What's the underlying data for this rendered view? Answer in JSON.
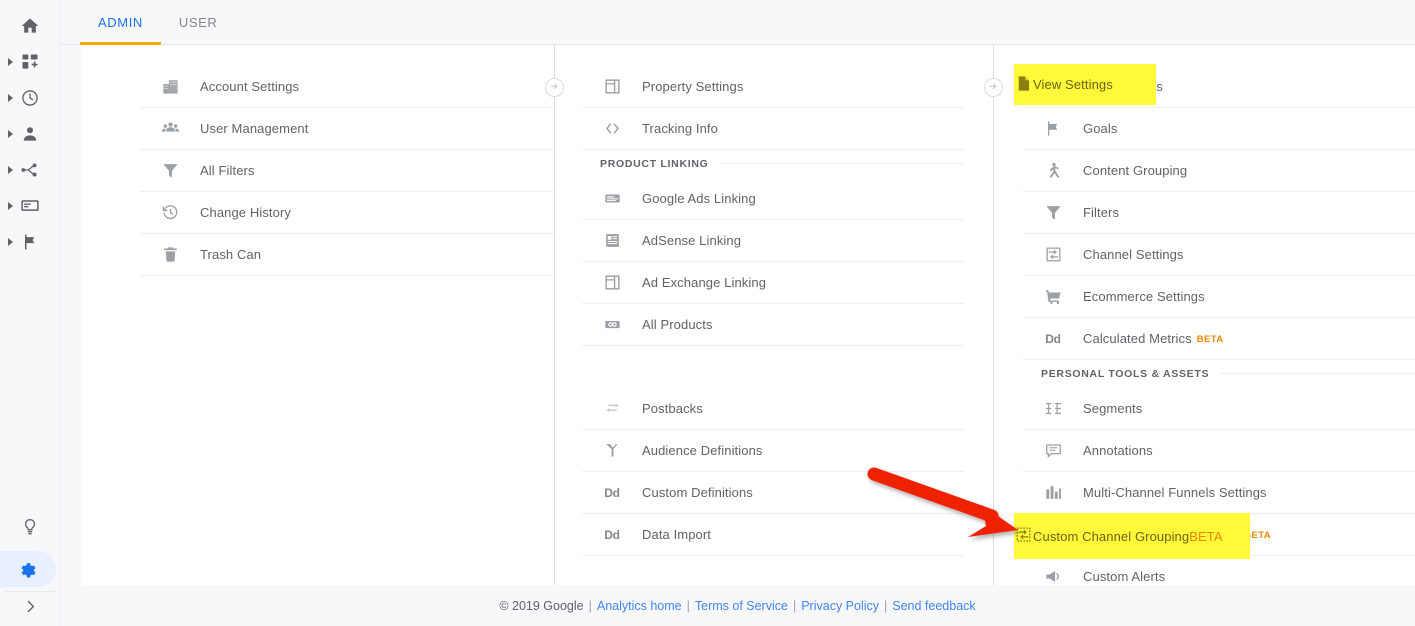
{
  "app": {
    "title": "Google Analytics Admin",
    "accent_blue": "#1a73e8",
    "accent_yellow": "#f9ab00",
    "highlight_color": "#fff93a",
    "annotation_color": "#ee2400"
  },
  "sidebar": {
    "items": [
      {
        "name": "home",
        "label": "Home",
        "icon": "home-icon",
        "expandable": false
      },
      {
        "name": "customization",
        "label": "Customization",
        "icon": "customization-icon",
        "expandable": true
      },
      {
        "name": "realtime",
        "label": "Realtime",
        "icon": "clock-icon",
        "expandable": true
      },
      {
        "name": "audience",
        "label": "Audience",
        "icon": "person-icon",
        "expandable": true
      },
      {
        "name": "acquisition",
        "label": "Acquisition",
        "icon": "share-nodes-icon",
        "expandable": true
      },
      {
        "name": "behavior",
        "label": "Behavior",
        "icon": "window-icon",
        "expandable": true
      },
      {
        "name": "conversions",
        "label": "Conversions",
        "icon": "flag-icon",
        "expandable": true
      }
    ],
    "bottom": [
      {
        "name": "discover",
        "label": "Discover",
        "icon": "lightbulb-icon",
        "active": false
      },
      {
        "name": "admin",
        "label": "Admin",
        "icon": "gear-icon",
        "active": true
      }
    ],
    "expand": {
      "name": "expand-sidebar",
      "label": "Expand",
      "icon": "chevron-right-icon"
    }
  },
  "tabs": [
    {
      "label": "ADMIN",
      "active": true
    },
    {
      "label": "USER",
      "active": false
    }
  ],
  "columns": {
    "account": {
      "name": "account-column",
      "rows": [
        {
          "label": "Account Settings",
          "icon": "building-icon"
        },
        {
          "label": "User Management",
          "icon": "users-icon"
        },
        {
          "label": "All Filters",
          "icon": "funnel-icon"
        },
        {
          "label": "Change History",
          "icon": "history-icon"
        },
        {
          "label": "Trash Can",
          "icon": "trash-icon"
        }
      ]
    },
    "property": {
      "name": "property-column",
      "rows": [
        {
          "label": "Property Settings",
          "icon": "layout-icon"
        },
        {
          "label": "Tracking Info",
          "icon": "code-icon"
        },
        {
          "type": "section",
          "label": "PRODUCT LINKING"
        },
        {
          "label": "Google Ads Linking",
          "icon": "ads-icon"
        },
        {
          "label": "AdSense Linking",
          "icon": "adsense-icon"
        },
        {
          "label": "Ad Exchange Linking",
          "icon": "layout-icon"
        },
        {
          "label": "All Products",
          "icon": "link-icon"
        },
        {
          "type": "spacer"
        },
        {
          "label": "Postbacks",
          "icon": "postback-icon"
        },
        {
          "label": "Audience Definitions",
          "icon": "audience-icon"
        },
        {
          "label": "Custom Definitions",
          "icon": "dd-icon"
        },
        {
          "label": "Data Import",
          "icon": "dd-icon"
        }
      ]
    },
    "view": {
      "name": "view-column",
      "rows": [
        {
          "label": "View Settings",
          "icon": "document-icon",
          "highlighted": true
        },
        {
          "label": "Goals",
          "icon": "flag-icon"
        },
        {
          "label": "Content Grouping",
          "icon": "content-grouping-icon"
        },
        {
          "label": "Filters",
          "icon": "funnel-icon"
        },
        {
          "label": "Channel Settings",
          "icon": "channel-icon"
        },
        {
          "label": "Ecommerce Settings",
          "icon": "cart-icon"
        },
        {
          "label": "Calculated Metrics",
          "icon": "dd-icon",
          "badge": "BETA"
        },
        {
          "type": "section",
          "label": "PERSONAL TOOLS & ASSETS"
        },
        {
          "label": "Segments",
          "icon": "segments-icon"
        },
        {
          "label": "Annotations",
          "icon": "annotation-icon"
        },
        {
          "label": "Multi-Channel Funnels Settings",
          "icon": "bars-icon"
        },
        {
          "label": "Custom Channel Grouping",
          "icon": "channel-icon",
          "badge": "BETA",
          "highlighted": true
        },
        {
          "label": "Custom Alerts",
          "icon": "megaphone-icon"
        }
      ]
    }
  },
  "highlights": {
    "view_settings": {
      "label": "View Settings",
      "badge": ""
    },
    "custom_channel_grouping": {
      "label": "Custom Channel Grouping",
      "badge": "BETA"
    }
  },
  "footer": {
    "copyright": "© 2019 Google",
    "links": [
      {
        "label": "Analytics home"
      },
      {
        "label": "Terms of Service"
      },
      {
        "label": "Privacy Policy"
      },
      {
        "label": "Send feedback"
      }
    ],
    "separator": "|"
  }
}
